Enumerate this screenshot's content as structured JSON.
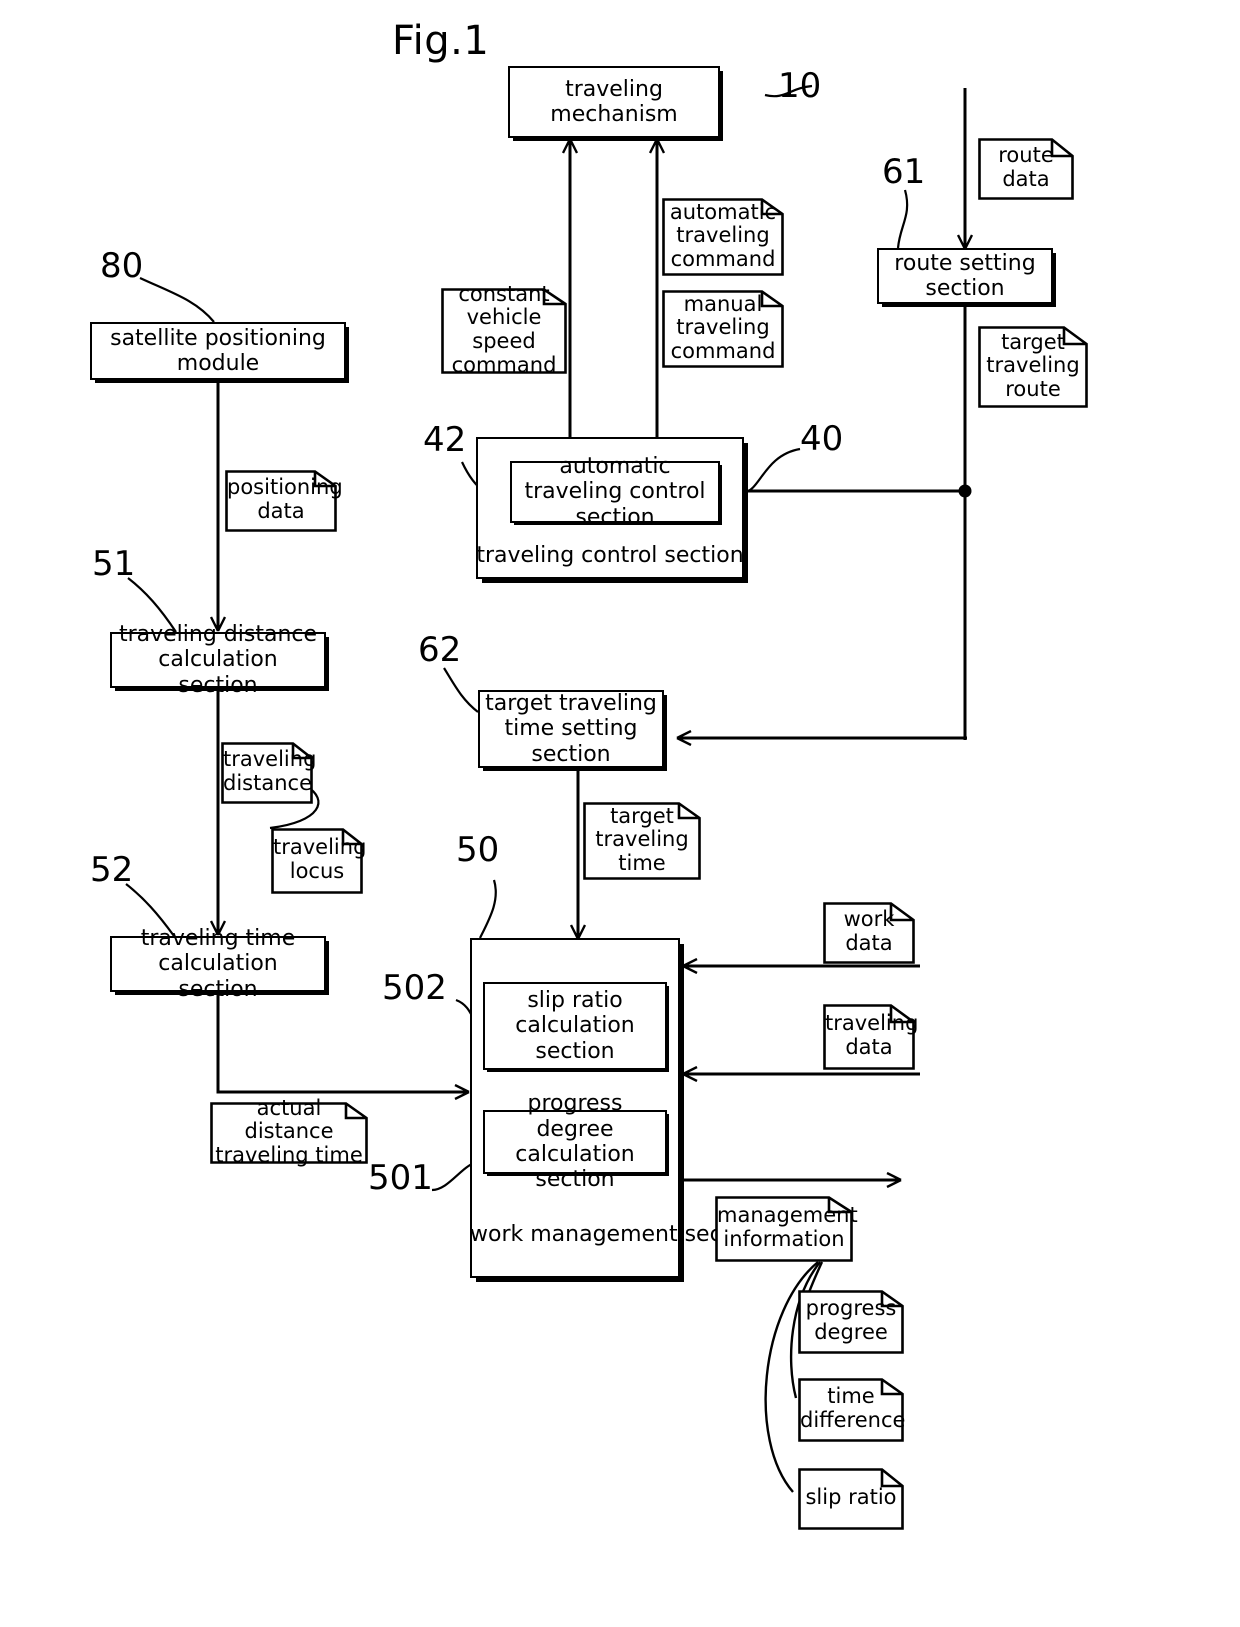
{
  "figure": {
    "label": "Fig.1"
  },
  "boxes": {
    "traveling_mechanism": "traveling mechanism",
    "route_setting_section": "route setting section",
    "automatic_traveling_control_section": "automatic traveling control section",
    "traveling_control_section": "traveling control section",
    "satellite_positioning_module": "satellite positioning module",
    "traveling_distance_calculation_section": "traveling distance calculation section",
    "traveling_time_calculation_section": "traveling time calculation section",
    "target_traveling_time_setting_section": "target traveling time setting section",
    "slip_ratio_calculation_section": "slip ratio calculation section",
    "progress_degree_calculation_section": "progress degree calculation section",
    "work_management_section": "work management section"
  },
  "notes": {
    "route_data": "route data",
    "target_traveling_route": "target traveling route",
    "automatic_traveling_command": "automatic traveling command",
    "manual_traveling_command": "manual traveling command",
    "constant_vehicle_speed_command": "constant vehicle speed command",
    "positioning_data": "positioning data",
    "traveling_distance": "traveling distance",
    "traveling_locus": "traveling locus",
    "target_traveling_time": "target traveling time",
    "actual_distance_traveling_time": "actual distance traveling time",
    "work_data": "work data",
    "traveling_data": "traveling data",
    "management_information": "management information",
    "progress_degree": "progress degree",
    "time_difference": "time difference",
    "slip_ratio": "slip ratio"
  },
  "reference_numerals": {
    "n10": "10",
    "n61": "61",
    "n42": "42",
    "n40": "40",
    "n80": "80",
    "n51": "51",
    "n52": "52",
    "n62": "62",
    "n50": "50",
    "n502": "502",
    "n501": "501"
  },
  "colors": {
    "line": "#000000",
    "background": "#ffffff",
    "text": "#000000"
  }
}
